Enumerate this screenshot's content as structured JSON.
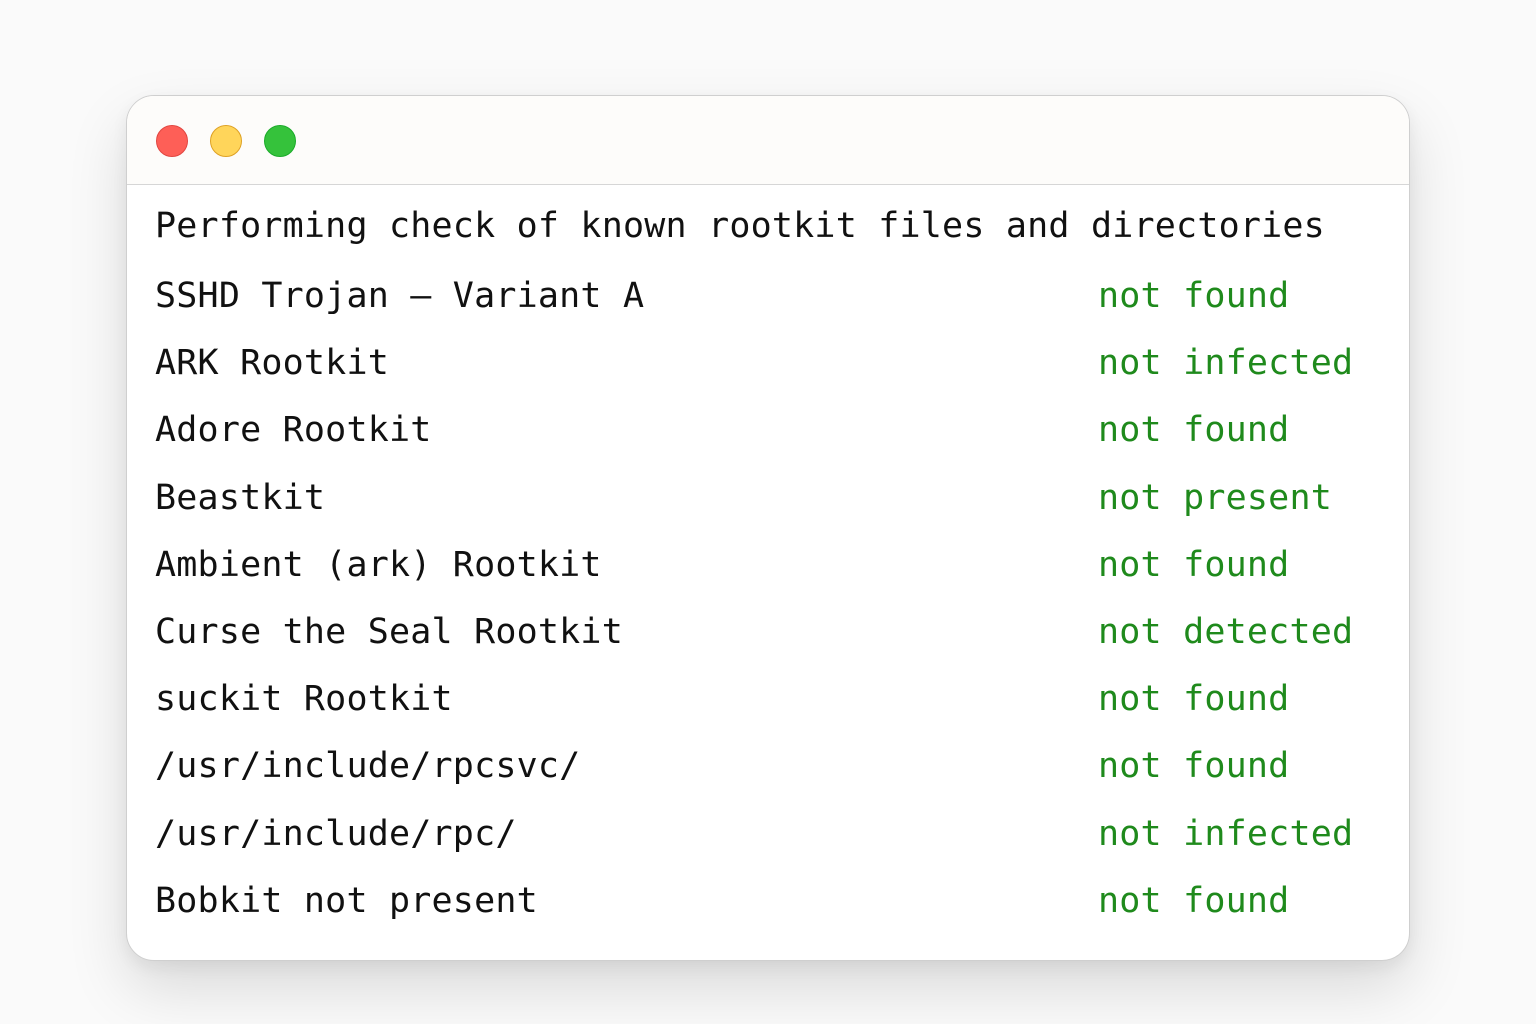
{
  "window": {
    "traffic_lights": [
      "close",
      "minimize",
      "maximize"
    ],
    "colors": {
      "close": "#fe5f57",
      "minimize": "#ffd55a",
      "maximize": "#35c23b",
      "status_text": "#1f8a1c"
    }
  },
  "terminal": {
    "heading": "Performing check of known rootkit files and directories",
    "rows": [
      {
        "name": "SSHD Trojan – Variant A",
        "status": "not found"
      },
      {
        "name": "ARK Rootkit",
        "status": "not infected"
      },
      {
        "name": "Adore Rootkit",
        "status": "not found"
      },
      {
        "name": "Beastkit",
        "status": "not present"
      },
      {
        "name": "Ambient (ark) Rootkit",
        "status": "not found"
      },
      {
        "name": "Curse the Seal Rootkit",
        "status": "not detected"
      },
      {
        "name": "suckit Rootkit",
        "status": "not found"
      },
      {
        "name": "/usr/include/rpcsvc/",
        "status": "not found"
      },
      {
        "name": "/usr/include/rpc/",
        "status": "not infected"
      },
      {
        "name": "Bobkit not present",
        "status": "not found"
      }
    ]
  }
}
